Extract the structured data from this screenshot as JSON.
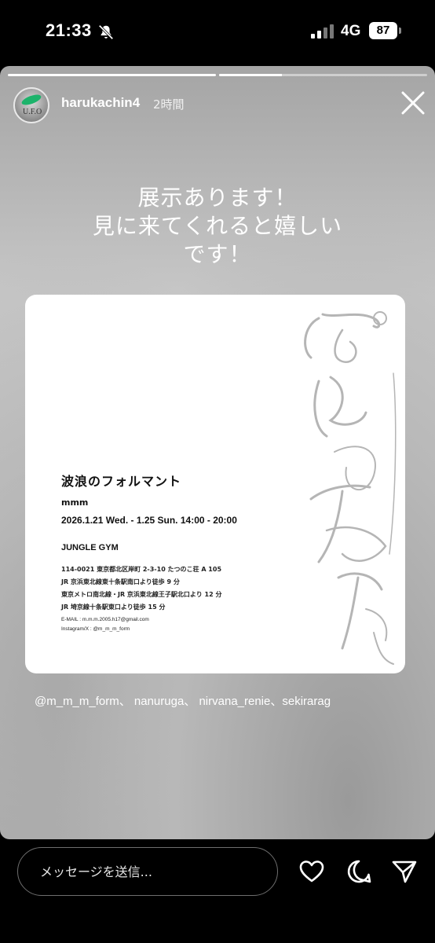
{
  "status_bar": {
    "time": "21:33",
    "network": "4G",
    "battery": "87"
  },
  "story": {
    "username": "harukachin4",
    "time_ago": "2時間",
    "avatar_text": "U.F.O",
    "progress": [
      1,
      0.3
    ],
    "caption": [
      "展示あります！",
      "見に来てくれると嬉しい",
      "です！"
    ],
    "mentions": "@m_m_m_form、 nanuruga、 nirvana_renie、sekirarag"
  },
  "flyer": {
    "title": "波浪のフォルマント",
    "artist": "mmm",
    "dates": "2026.1.21 Wed. - 1.25 Sun. 14:00 - 20:00",
    "venue": "JUNGLE GYM",
    "address_lines": [
      "114-0021 東京都北区岸町 2-3-10 たつのこ荘 A 105",
      "JR 京浜東北線東十条駅南口より徒歩 9 分",
      "東京メトロ南北線・JR 京浜東北線王子駅北口より 12 分",
      "JR 埼京線十条駅東口より徒歩 15 分"
    ],
    "email": "E-MAIL : m.m.m.2005.h17@gmail.com",
    "instagram": "Instagram/X : @m_m_m_form"
  },
  "bottom_bar": {
    "message_placeholder": "メッセージを送信...",
    "icons": [
      "heart-icon",
      "comment-icon",
      "send-icon"
    ]
  }
}
